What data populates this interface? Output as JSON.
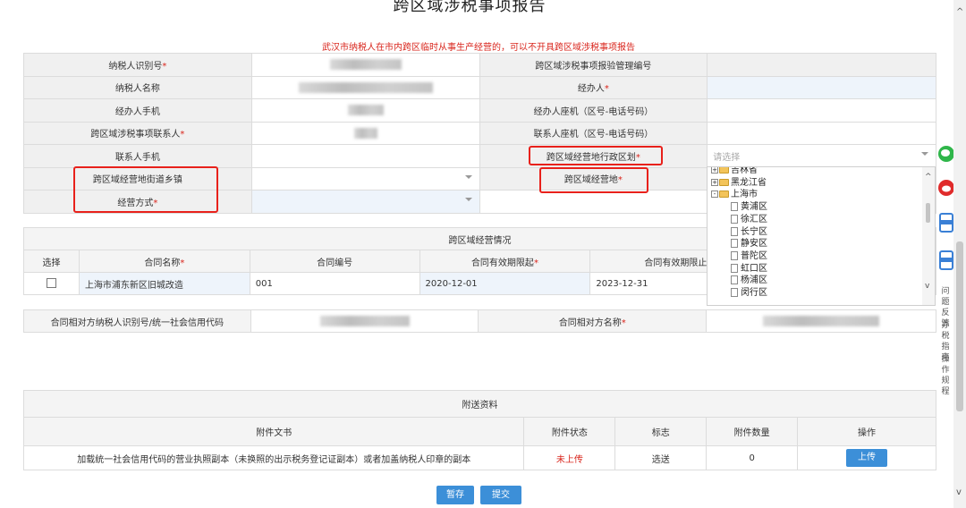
{
  "page": {
    "title": "跨区域涉税事项报告",
    "notice": "武汉市纳税人在市内跨区临时从事生产经营的，可以不开具跨区域涉税事项报告"
  },
  "form": {
    "taxpayer_id_label": "纳税人识别号",
    "report_mgmt_no_label": "跨区域涉税事项报验管理编号",
    "taxpayer_name_label": "纳税人名称",
    "handler_label": "经办人",
    "handler_mobile_label": "经办人手机",
    "handler_landline_label": "经办人座机（区号-电话号码）",
    "contact_label": "跨区域涉税事项联系人",
    "contact_landline_label": "联系人座机（区号-电话号码）",
    "contact_mobile_label": "联系人手机",
    "admin_region_label": "跨区域经营地行政区划",
    "admin_region_placeholder": "请选择",
    "street_label": "跨区域经营地街道乡镇",
    "place_label": "跨区域经营地",
    "mode_label": "经营方式",
    "required_mark": "*"
  },
  "region_tree": [
    {
      "label": "吉林省",
      "type": "folder-plus"
    },
    {
      "label": "黑龙江省",
      "type": "folder-plus"
    },
    {
      "label": "上海市",
      "type": "folder-minus"
    },
    {
      "label": "黄浦区",
      "type": "leaf"
    },
    {
      "label": "徐汇区",
      "type": "leaf"
    },
    {
      "label": "长宁区",
      "type": "leaf"
    },
    {
      "label": "静安区",
      "type": "leaf"
    },
    {
      "label": "普陀区",
      "type": "leaf"
    },
    {
      "label": "虹口区",
      "type": "leaf"
    },
    {
      "label": "杨浦区",
      "type": "leaf"
    },
    {
      "label": "闵行区",
      "type": "leaf"
    }
  ],
  "operation": {
    "section_title": "跨区域经营情况",
    "headers": {
      "select": "选择",
      "name": "合同名称",
      "no": "合同编号",
      "start": "合同有效期限起",
      "end": "合同有效期限止"
    },
    "row": {
      "name": "上海市浦东新区旧城改造",
      "no": "001",
      "start": "2020-12-01",
      "end": "2023-12-31"
    },
    "counterparty_id_label": "合同相对方纳税人识别号/统一社会信用代码",
    "counterparty_name_label": "合同相对方名称"
  },
  "attachments": {
    "section_title": "附送资料",
    "headers": {
      "doc": "附件文书",
      "status": "附件状态",
      "flag": "标志",
      "count": "附件数量",
      "op": "操作"
    },
    "row": {
      "doc": "加载统一社会信用代码的营业执照副本（未换照的出示税务登记证副本）或者加盖纳税人印章的副本",
      "status": "未上传",
      "flag": "选送",
      "count": "0",
      "op": "上传"
    }
  },
  "buttons": {
    "save": "暂存",
    "submit": "提交"
  },
  "sidebar": {
    "feedback": "问题反馈",
    "guide": "办税指南",
    "procedure": "操作规程"
  },
  "colors": {
    "required": "#d9251c",
    "highlight_box": "#e8211b",
    "button": "#3c8fd8",
    "wechat": "#2fb64a",
    "weibo": "#e02b2b",
    "app": "#3a80d6"
  }
}
